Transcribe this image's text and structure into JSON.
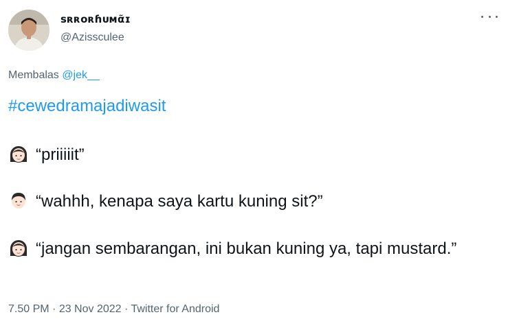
{
  "author": {
    "display_name": "ꜱʀʀᴏʀɦᴜᴍᾶɪ",
    "handle": "@Azissculee",
    "avatar_icon": "profile-photo"
  },
  "reply": {
    "prefix": "Membalas",
    "mention": "@jek__"
  },
  "hashtag": "#cewedramajadiwasit",
  "dialogue": [
    {
      "emoji": "girl-face-emoji",
      "text": "“priiiiit”"
    },
    {
      "emoji": "boy-face-emoji",
      "text": "“wahhh, kenapa saya kartu kuning sit?”"
    },
    {
      "emoji": "girl-face-emoji",
      "text": "“jangan sembarangan, ini bukan kuning ya, tapi mustard.”"
    }
  ],
  "meta": {
    "time": "7.50 PM",
    "sep1": " · ",
    "date": "23 Nov 2022",
    "sep2": " · ",
    "source": "Twitter for Android"
  },
  "colors": {
    "link": "#1d9bf0",
    "secondary_text": "#536471",
    "primary_text": "#0f1419"
  }
}
